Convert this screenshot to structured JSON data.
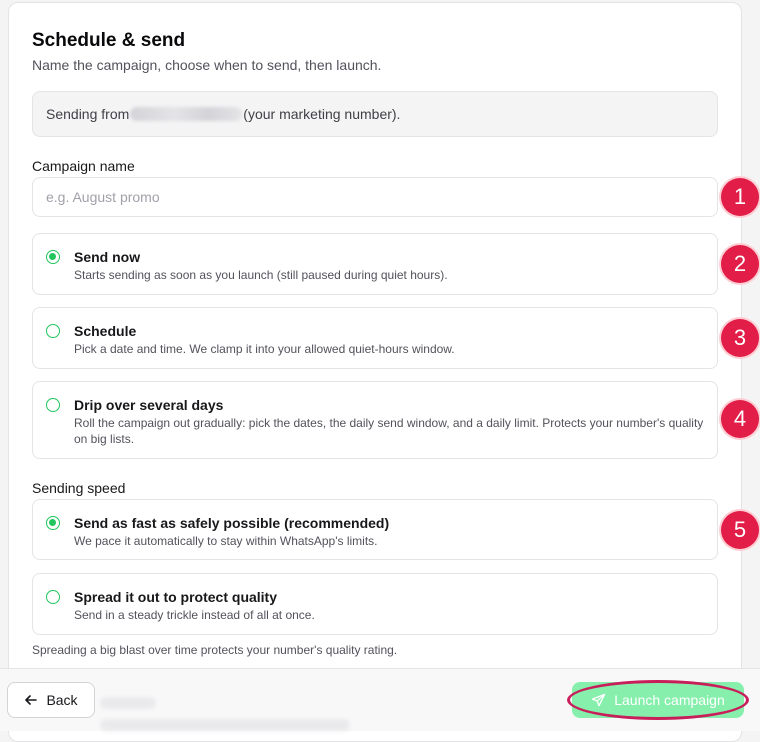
{
  "header": {
    "title": "Schedule & send",
    "subtitle": "Name the campaign, choose when to send, then launch."
  },
  "sender": {
    "prefix": "Sending from",
    "suffix": "(your marketing number)."
  },
  "campaign_name": {
    "label": "Campaign name",
    "value": "",
    "placeholder": "e.g. August promo"
  },
  "timing_options": [
    {
      "title": "Send now",
      "description": "Starts sending as soon as you launch (still paused during quiet hours).",
      "selected": true
    },
    {
      "title": "Schedule",
      "description": "Pick a date and time. We clamp it into your allowed quiet-hours window.",
      "selected": false
    },
    {
      "title": "Drip over several days",
      "description": "Roll the campaign out gradually: pick the dates, the daily send window, and a daily limit. Protects your number's quality on big lists.",
      "selected": false
    }
  ],
  "speed": {
    "label": "Sending speed",
    "options": [
      {
        "title": "Send as fast as safely possible (recommended)",
        "description": "We pace it automatically to stay within WhatsApp's limits.",
        "selected": true
      },
      {
        "title": "Spread it out to protect quality",
        "description": "Send in a steady trickle instead of all at once.",
        "selected": false
      }
    ],
    "note": "Spreading a big blast over time protects your number's quality rating."
  },
  "annotations": [
    "1",
    "2",
    "3",
    "4",
    "5"
  ],
  "footer": {
    "back_label": "Back",
    "back_icon": "arrow-left-icon",
    "launch_label": "Launch campaign",
    "launch_icon": "send-icon"
  },
  "colors": {
    "accent": "#22c55e",
    "launch_button": "#86efac",
    "annotation": "#e11d48"
  }
}
